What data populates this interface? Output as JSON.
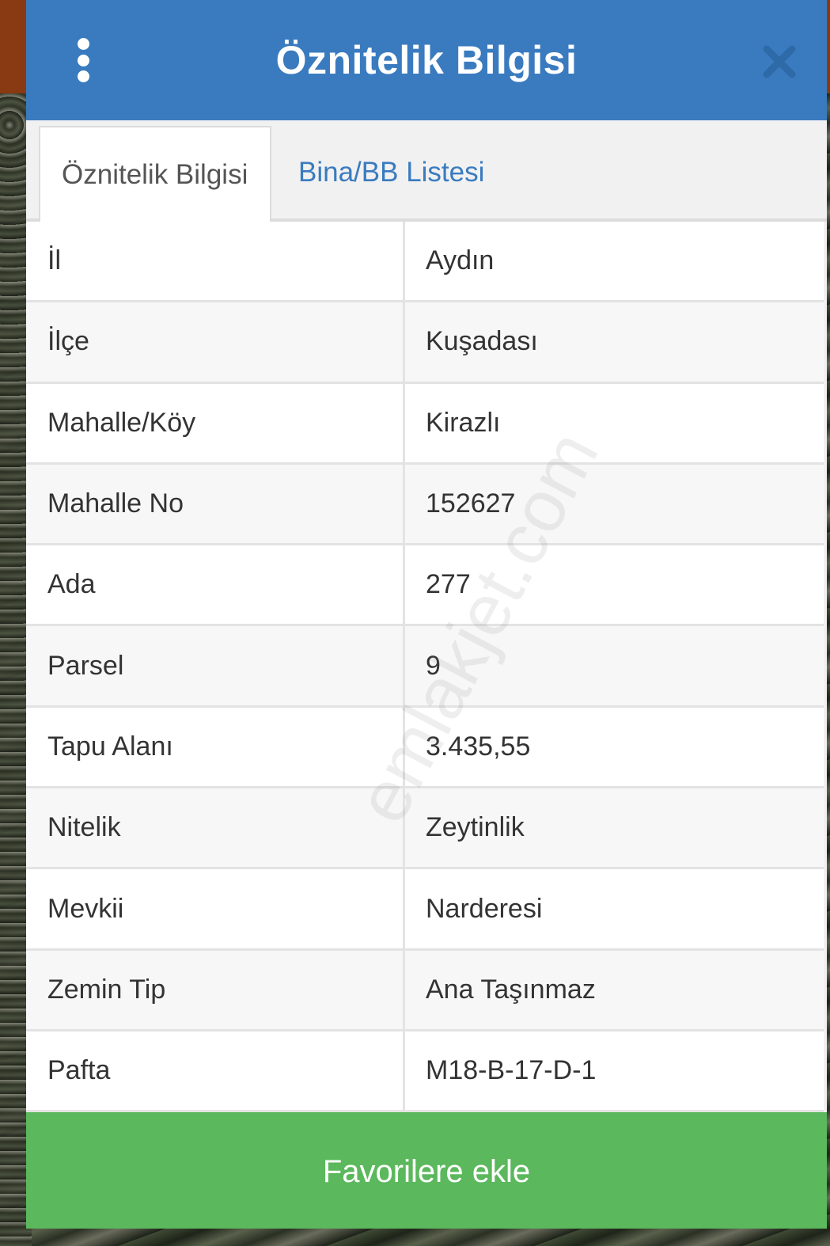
{
  "header": {
    "title": "Öznitelik Bilgisi"
  },
  "tabs": [
    {
      "label": "Öznitelik Bilgisi",
      "active": true
    },
    {
      "label": "Bina/BB Listesi",
      "active": false
    }
  ],
  "table": {
    "rows": [
      {
        "key": "İl",
        "value": "Aydın"
      },
      {
        "key": "İlçe",
        "value": "Kuşadası"
      },
      {
        "key": "Mahalle/Köy",
        "value": "Kirazlı"
      },
      {
        "key": "Mahalle No",
        "value": "152627"
      },
      {
        "key": "Ada",
        "value": "277"
      },
      {
        "key": "Parsel",
        "value": "9"
      },
      {
        "key": "Tapu Alanı",
        "value": "3.435,55"
      },
      {
        "key": "Nitelik",
        "value": "Zeytinlik"
      },
      {
        "key": "Mevkii",
        "value": "Narderesi"
      },
      {
        "key": "Zemin Tip",
        "value": "Ana Taşınmaz"
      },
      {
        "key": "Pafta",
        "value": "M18-B-17-D-1"
      }
    ]
  },
  "footer": {
    "favorite_label": "Favorilere ekle"
  },
  "watermark": "emlakjet.com",
  "colors": {
    "header_bg": "#3a7bbf",
    "tab_inactive_text": "#3a7bbf",
    "favorite_bg": "#5bb85c",
    "close_icon": "#2e6aa8"
  },
  "icons": {
    "menu": "vertical-dots-icon",
    "close": "close-icon"
  }
}
